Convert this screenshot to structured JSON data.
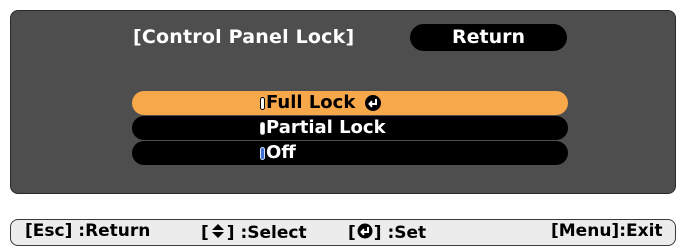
{
  "window": {
    "title": "[Control Panel Lock]",
    "return_label": "Return"
  },
  "options": [
    {
      "label": "Full Lock",
      "selected": true,
      "radio_on": false,
      "show_enter_icon": true
    },
    {
      "label": "Partial Lock",
      "selected": false,
      "radio_on": false,
      "show_enter_icon": false
    },
    {
      "label": "Off",
      "selected": false,
      "radio_on": true,
      "show_enter_icon": false
    }
  ],
  "status_bar": {
    "esc_label": "[Esc] :Return",
    "select_prefix": "[",
    "select_suffix": "] :Select",
    "set_prefix": "[",
    "set_suffix": "] :Set",
    "menu_label": "[Menu]:Exit"
  },
  "icons": {
    "enter": "enter-icon",
    "updown": "up-down-arrow-icon",
    "radio": "radio-indicator-icon"
  },
  "colors": {
    "panel_bg": "#4e4e4e",
    "selection": "#f7a84b",
    "option_bg": "#000000",
    "radio_on": "#3f6fd1",
    "status_bg": "#ececec"
  }
}
